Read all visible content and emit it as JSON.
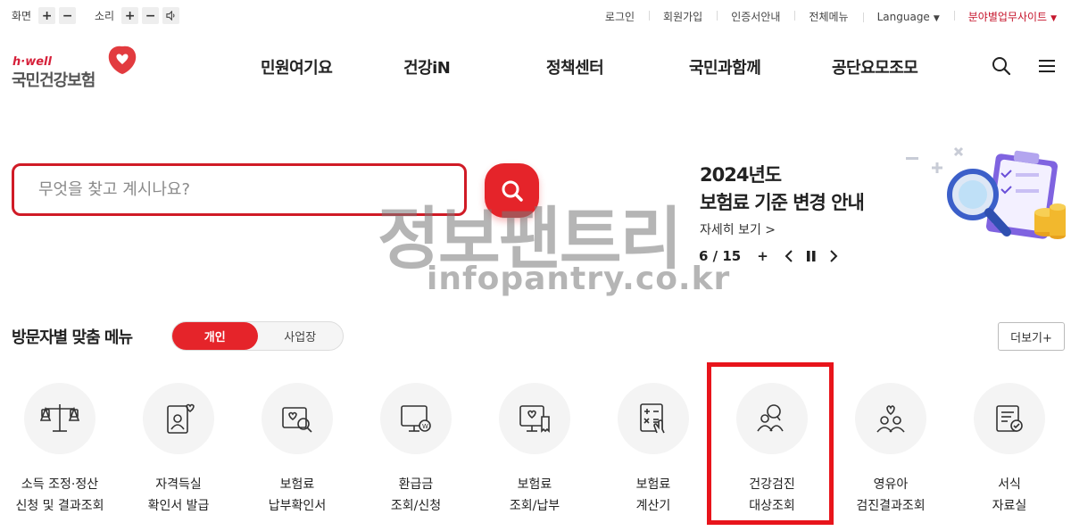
{
  "utility": {
    "screen_label": "화면",
    "sound_label": "소리",
    "plus": "+",
    "minus": "−",
    "links": [
      "로그인",
      "회원가입",
      "인증서안내",
      "전체메뉴"
    ],
    "language": "Language",
    "business_site": "분야별업무사이트"
  },
  "logo": {
    "tagline": "h·well",
    "name": "국민건강보험"
  },
  "gnb": [
    "민원여기요",
    "건강iN",
    "정책센터",
    "국민과함께",
    "공단요모조모"
  ],
  "search": {
    "placeholder": "무엇을 찾고 계시나요?"
  },
  "banner": {
    "title_line1": "2024년도",
    "title_line2": "보험료 기준 변경 안내",
    "more": "자세히 보기 >",
    "pager": "6 / 15",
    "plus": "+"
  },
  "watermark": {
    "main": "정보팬트리",
    "url": "infopantry.co.kr"
  },
  "section": {
    "title": "방문자별 맞춤 메뉴",
    "tabs": [
      "개인",
      "사업장"
    ],
    "active_tab": "개인",
    "more_button": "더보기+"
  },
  "menu_items": [
    {
      "line1": "소득 조정·정산",
      "line2": "신청 및 결과조회",
      "icon": "scale-icon"
    },
    {
      "line1": "자격득실",
      "line2": "확인서 발급",
      "icon": "id-card-heart-icon"
    },
    {
      "line1": "보험료",
      "line2": "납부확인서",
      "icon": "document-search-icon"
    },
    {
      "line1": "환급금",
      "line2": "조회/신청",
      "icon": "monitor-coin-icon"
    },
    {
      "line1": "보험료",
      "line2": "조회/납부",
      "icon": "monitor-receipt-icon"
    },
    {
      "line1": "보험료",
      "line2": "계산기",
      "icon": "calculator-icon"
    },
    {
      "line1": "건강검진",
      "line2": "대상조회",
      "icon": "group-search-icon"
    },
    {
      "line1": "영유아",
      "line2": "검진결과조회",
      "icon": "family-heart-icon"
    },
    {
      "line1": "서식",
      "line2": "자료실",
      "icon": "form-check-icon"
    }
  ],
  "colors": {
    "accent": "#e5242a",
    "highlight": "#e8141b",
    "logo_red": "#d6203a"
  }
}
